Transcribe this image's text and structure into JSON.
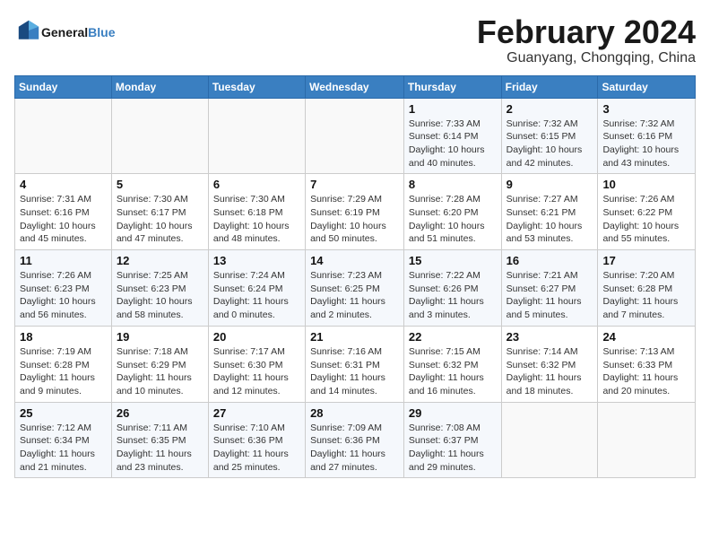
{
  "logo": {
    "text_general": "General",
    "text_blue": "Blue"
  },
  "header": {
    "title": "February 2024",
    "subtitle": "Guanyang, Chongqing, China"
  },
  "weekdays": [
    "Sunday",
    "Monday",
    "Tuesday",
    "Wednesday",
    "Thursday",
    "Friday",
    "Saturday"
  ],
  "weeks": [
    [
      {
        "day": "",
        "info": ""
      },
      {
        "day": "",
        "info": ""
      },
      {
        "day": "",
        "info": ""
      },
      {
        "day": "",
        "info": ""
      },
      {
        "day": "1",
        "info": "Sunrise: 7:33 AM\nSunset: 6:14 PM\nDaylight: 10 hours\nand 40 minutes."
      },
      {
        "day": "2",
        "info": "Sunrise: 7:32 AM\nSunset: 6:15 PM\nDaylight: 10 hours\nand 42 minutes."
      },
      {
        "day": "3",
        "info": "Sunrise: 7:32 AM\nSunset: 6:16 PM\nDaylight: 10 hours\nand 43 minutes."
      }
    ],
    [
      {
        "day": "4",
        "info": "Sunrise: 7:31 AM\nSunset: 6:16 PM\nDaylight: 10 hours\nand 45 minutes."
      },
      {
        "day": "5",
        "info": "Sunrise: 7:30 AM\nSunset: 6:17 PM\nDaylight: 10 hours\nand 47 minutes."
      },
      {
        "day": "6",
        "info": "Sunrise: 7:30 AM\nSunset: 6:18 PM\nDaylight: 10 hours\nand 48 minutes."
      },
      {
        "day": "7",
        "info": "Sunrise: 7:29 AM\nSunset: 6:19 PM\nDaylight: 10 hours\nand 50 minutes."
      },
      {
        "day": "8",
        "info": "Sunrise: 7:28 AM\nSunset: 6:20 PM\nDaylight: 10 hours\nand 51 minutes."
      },
      {
        "day": "9",
        "info": "Sunrise: 7:27 AM\nSunset: 6:21 PM\nDaylight: 10 hours\nand 53 minutes."
      },
      {
        "day": "10",
        "info": "Sunrise: 7:26 AM\nSunset: 6:22 PM\nDaylight: 10 hours\nand 55 minutes."
      }
    ],
    [
      {
        "day": "11",
        "info": "Sunrise: 7:26 AM\nSunset: 6:23 PM\nDaylight: 10 hours\nand 56 minutes."
      },
      {
        "day": "12",
        "info": "Sunrise: 7:25 AM\nSunset: 6:23 PM\nDaylight: 10 hours\nand 58 minutes."
      },
      {
        "day": "13",
        "info": "Sunrise: 7:24 AM\nSunset: 6:24 PM\nDaylight: 11 hours\nand 0 minutes."
      },
      {
        "day": "14",
        "info": "Sunrise: 7:23 AM\nSunset: 6:25 PM\nDaylight: 11 hours\nand 2 minutes."
      },
      {
        "day": "15",
        "info": "Sunrise: 7:22 AM\nSunset: 6:26 PM\nDaylight: 11 hours\nand 3 minutes."
      },
      {
        "day": "16",
        "info": "Sunrise: 7:21 AM\nSunset: 6:27 PM\nDaylight: 11 hours\nand 5 minutes."
      },
      {
        "day": "17",
        "info": "Sunrise: 7:20 AM\nSunset: 6:28 PM\nDaylight: 11 hours\nand 7 minutes."
      }
    ],
    [
      {
        "day": "18",
        "info": "Sunrise: 7:19 AM\nSunset: 6:28 PM\nDaylight: 11 hours\nand 9 minutes."
      },
      {
        "day": "19",
        "info": "Sunrise: 7:18 AM\nSunset: 6:29 PM\nDaylight: 11 hours\nand 10 minutes."
      },
      {
        "day": "20",
        "info": "Sunrise: 7:17 AM\nSunset: 6:30 PM\nDaylight: 11 hours\nand 12 minutes."
      },
      {
        "day": "21",
        "info": "Sunrise: 7:16 AM\nSunset: 6:31 PM\nDaylight: 11 hours\nand 14 minutes."
      },
      {
        "day": "22",
        "info": "Sunrise: 7:15 AM\nSunset: 6:32 PM\nDaylight: 11 hours\nand 16 minutes."
      },
      {
        "day": "23",
        "info": "Sunrise: 7:14 AM\nSunset: 6:32 PM\nDaylight: 11 hours\nand 18 minutes."
      },
      {
        "day": "24",
        "info": "Sunrise: 7:13 AM\nSunset: 6:33 PM\nDaylight: 11 hours\nand 20 minutes."
      }
    ],
    [
      {
        "day": "25",
        "info": "Sunrise: 7:12 AM\nSunset: 6:34 PM\nDaylight: 11 hours\nand 21 minutes."
      },
      {
        "day": "26",
        "info": "Sunrise: 7:11 AM\nSunset: 6:35 PM\nDaylight: 11 hours\nand 23 minutes."
      },
      {
        "day": "27",
        "info": "Sunrise: 7:10 AM\nSunset: 6:36 PM\nDaylight: 11 hours\nand 25 minutes."
      },
      {
        "day": "28",
        "info": "Sunrise: 7:09 AM\nSunset: 6:36 PM\nDaylight: 11 hours\nand 27 minutes."
      },
      {
        "day": "29",
        "info": "Sunrise: 7:08 AM\nSunset: 6:37 PM\nDaylight: 11 hours\nand 29 minutes."
      },
      {
        "day": "",
        "info": ""
      },
      {
        "day": "",
        "info": ""
      }
    ]
  ]
}
